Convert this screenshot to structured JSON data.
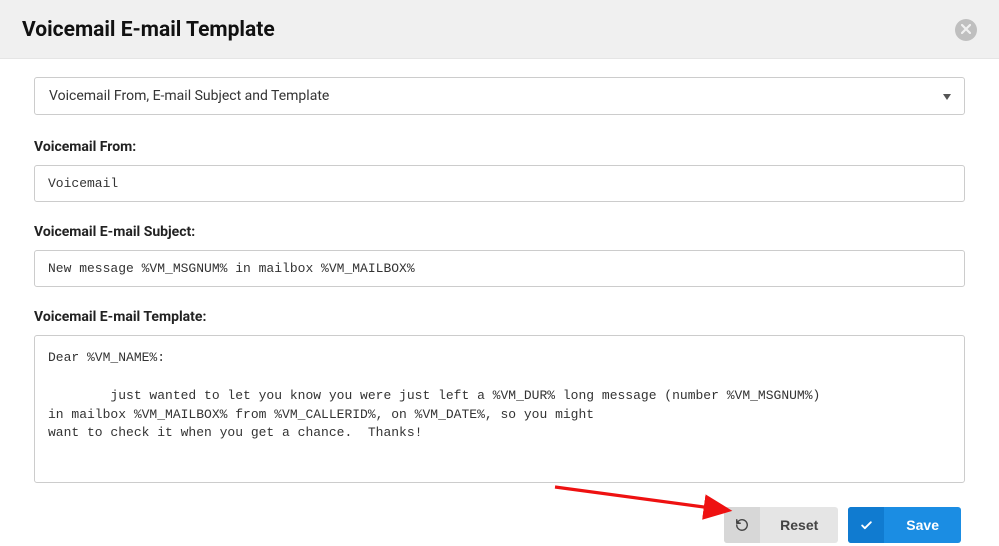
{
  "header": {
    "title": "Voicemail E-mail Template"
  },
  "dropdown": {
    "selected": "Voicemail From, E-mail Subject and Template"
  },
  "from": {
    "label": "Voicemail From:",
    "value": "Voicemail"
  },
  "subject": {
    "label": "Voicemail E-mail Subject:",
    "value": "New message %VM_MSGNUM% in mailbox %VM_MAILBOX%"
  },
  "template": {
    "label": "Voicemail E-mail Template:",
    "value": "Dear %VM_NAME%:\n\n        just wanted to let you know you were just left a %VM_DUR% long message (number %VM_MSGNUM%)\nin mailbox %VM_MAILBOX% from %VM_CALLERID%, on %VM_DATE%, so you might\nwant to check it when you get a chance.  Thanks!"
  },
  "actions": {
    "reset": "Reset",
    "save": "Save"
  }
}
